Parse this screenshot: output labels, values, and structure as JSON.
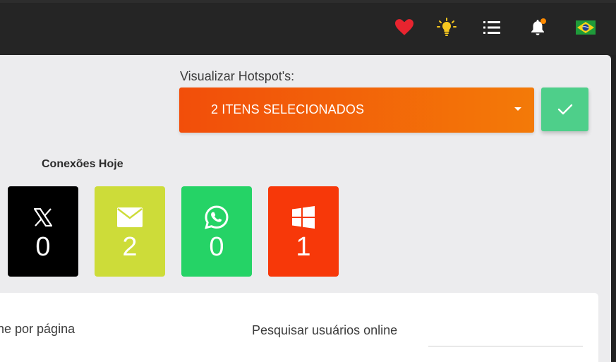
{
  "topbar": {
    "icons": [
      "heart-icon",
      "lightbulb-icon",
      "list-icon",
      "bell-icon",
      "brazil-flag-icon"
    ],
    "colors": {
      "heart": "#e8242f",
      "bulb": "#f7c81f",
      "notif_dot": "#ff8a00"
    }
  },
  "hotspot": {
    "label": "Visualizar Hotspot's:",
    "selected": "2 ITENS SELECIONADOS",
    "colors": {
      "gradient_start": "#f24e0a",
      "gradient_end": "#f37a08",
      "confirm": "#4ecf8a"
    }
  },
  "connections": {
    "title": "Conexões Hoje",
    "cards": [
      {
        "icon": "x-twitter-icon",
        "value": "0",
        "color": "#000000"
      },
      {
        "icon": "envelope-icon",
        "value": "2",
        "color": "#cddc39"
      },
      {
        "icon": "whatsapp-icon",
        "value": "0",
        "color": "#25d366"
      },
      {
        "icon": "windows-icon",
        "value": "1",
        "color": "#f73809"
      }
    ]
  },
  "table_controls": {
    "per_page": "ne por página",
    "search_label": "Pesquisar usuários online",
    "search_value": ""
  }
}
